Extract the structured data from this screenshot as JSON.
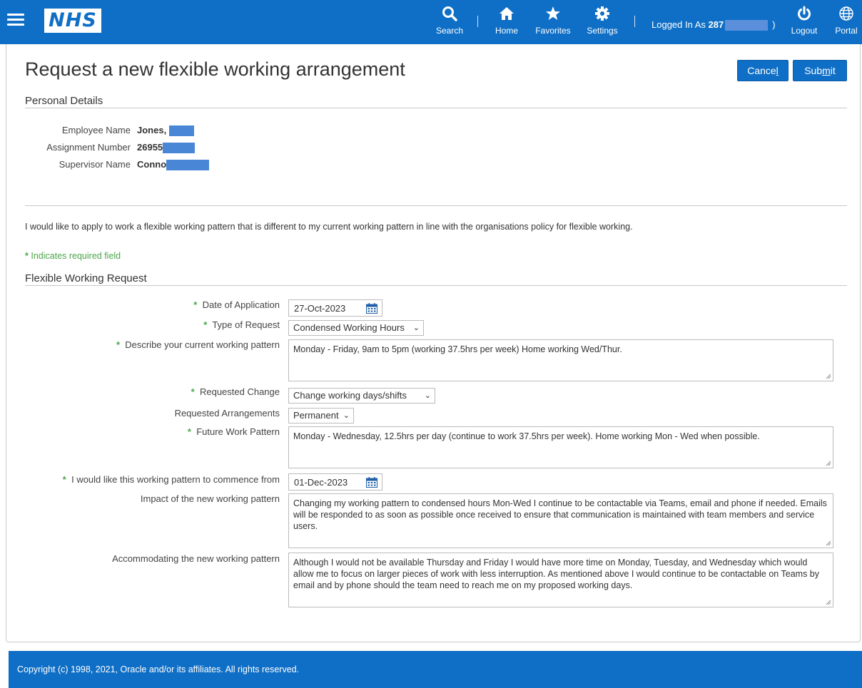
{
  "header": {
    "logo_text": "NHS",
    "nav": {
      "search": "Search",
      "home": "Home",
      "favorites": "Favorites",
      "settings": "Settings",
      "logout": "Logout",
      "portal": "Portal"
    },
    "logged_in_prefix": "Logged In As",
    "logged_in_user": "287",
    "logged_in_suffix": ")"
  },
  "page": {
    "title": "Request a new flexible working arrangement",
    "cancel_label_pre": "Cance",
    "cancel_label_ul": "l",
    "submit_label_pre": "Sub",
    "submit_label_ul": "m",
    "submit_label_post": "it"
  },
  "personal": {
    "heading": "Personal Details",
    "employee_label": "Employee Name",
    "employee_value": "Jones, ",
    "assignment_label": "Assignment Number",
    "assignment_value": "26955",
    "supervisor_label": "Supervisor Name",
    "supervisor_value": "Conno"
  },
  "intro_text": "I would like to apply to work a flexible working pattern that is different to my current working pattern in line with the organisations policy for flexible working.",
  "required_note": "Indicates required field",
  "required_star": "*",
  "form": {
    "heading": "Flexible Working Request",
    "date_label": "Date of Application",
    "date_value": "27-Oct-2023",
    "type_label": "Type of Request",
    "type_value": "Condensed Working Hours",
    "current_label": "Describe your current working pattern",
    "current_value": "Monday - Friday, 9am to 5pm (working 37.5hrs per week) Home working Wed/Thur.",
    "change_label": "Requested Change",
    "change_value": "Change working days/shifts",
    "arrangements_label": "Requested Arrangements",
    "arrangements_value": "Permanent",
    "future_label": "Future Work Pattern",
    "future_value": "Monday - Wednesday, 12.5hrs per day (continue to work 37.5hrs per week). Home working Mon - Wed when possible.",
    "commence_label": "I would like this working pattern to commence from",
    "commence_value": "01-Dec-2023",
    "impact_label": "Impact of the new working pattern",
    "impact_value": "Changing my working pattern to condensed hours Mon-Wed I continue to be contactable via Teams, email and phone if needed. Emails will be responded to as soon as possible once received to ensure that communication is maintained  with team members and service users.",
    "accommodating_label": "Accommodating the new working pattern",
    "accommodating_value": "Although I would not be available Thursday and Friday I would have more time on Monday, Tuesday, and Wednesday which would allow me to focus on larger pieces of work with less interruption. As mentioned above I would continue to be contactable on Teams by email and by phone should the team need to reach me on my proposed working days."
  },
  "footer": {
    "copyright": "Copyright (c) 1998, 2021, Oracle and/or its affiliates. All rights reserved."
  },
  "colors": {
    "brand_blue": "#0f6fc6",
    "required_green": "#4ca64c",
    "redaction": "#4a86d6"
  },
  "icons": [
    "menu-icon",
    "search-icon",
    "home-icon",
    "star-icon",
    "gear-icon",
    "power-icon",
    "globe-icon",
    "calendar-icon",
    "chevron-down-icon"
  ]
}
